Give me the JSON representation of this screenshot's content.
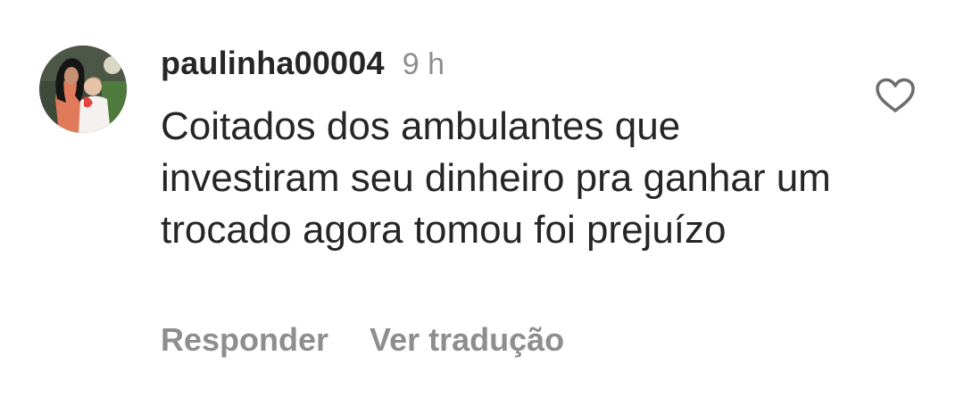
{
  "comment": {
    "avatar_icon": "user-avatar-photo",
    "username": "paulinha00004",
    "time": "9 h",
    "text": "Coitados dos ambulantes que investiram seu dinheiro pra ganhar um trocado agora tomou foi prejuízo",
    "actions": {
      "reply": "Responder",
      "translate": "Ver tradução"
    },
    "like_icon": "heart-outline-icon"
  },
  "colors": {
    "text_primary": "#262626",
    "text_secondary": "#8e8e8e",
    "background": "#ffffff"
  }
}
